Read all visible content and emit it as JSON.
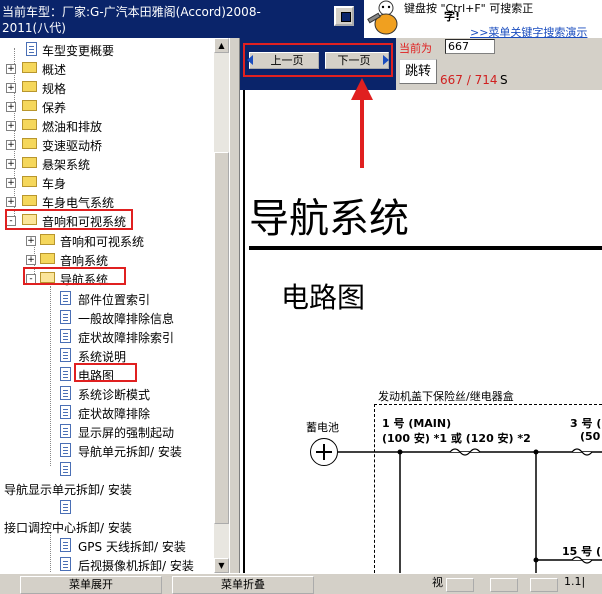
{
  "header": {
    "car_line1": "当前车型：厂家:G-广汽本田雅阁(Accord)2008-",
    "car_line2": "2011(八代)",
    "tip_line1": "键盘按 \"Ctrl+F\" 可搜索正",
    "tip_line2": "字!",
    "tip_link": ">>菜单关键字搜索演示"
  },
  "tree": {
    "items": [
      {
        "label": "车型变更概要",
        "type": "page"
      },
      {
        "label": "概述",
        "type": "folder"
      },
      {
        "label": "规格",
        "type": "folder"
      },
      {
        "label": "保养",
        "type": "folder"
      },
      {
        "label": "燃油和排放",
        "type": "folder"
      },
      {
        "label": "变速驱动桥",
        "type": "folder"
      },
      {
        "label": "悬架系统",
        "type": "folder"
      },
      {
        "label": "车身",
        "type": "folder"
      },
      {
        "label": "车身电气系统",
        "type": "folder"
      },
      {
        "label": "音响和可视系统",
        "type": "folder-open"
      },
      {
        "label": "音响和可视系统",
        "type": "folder"
      },
      {
        "label": "音响系统",
        "type": "folder"
      },
      {
        "label": "导航系统",
        "type": "folder-open"
      },
      {
        "label": "部件位置索引",
        "type": "page"
      },
      {
        "label": "一般故障排除信息",
        "type": "page"
      },
      {
        "label": "症状故障排除索引",
        "type": "page"
      },
      {
        "label": "系统说明",
        "type": "page"
      },
      {
        "label": "电路图",
        "type": "page"
      },
      {
        "label": "系统诊断模式",
        "type": "page"
      },
      {
        "label": "症状故障排除",
        "type": "page"
      },
      {
        "label": "显示屏的强制起动",
        "type": "page"
      },
      {
        "label": "导航单元拆卸/ 安装",
        "type": "page"
      },
      {
        "label": "",
        "type": "page"
      },
      {
        "label": "导航显示单元拆卸/ 安装",
        "type": "text"
      },
      {
        "label": "",
        "type": "page"
      },
      {
        "label": "接口调控中心拆卸/ 安装",
        "type": "text"
      },
      {
        "label": "GPS 天线拆卸/ 安装",
        "type": "page"
      },
      {
        "label": "后视摄像机拆卸/ 安装",
        "type": "page"
      }
    ]
  },
  "toolbar": {
    "prev_label": "上一页",
    "next_label": "下一页",
    "current_label": "当前为",
    "page_input_value": "667",
    "jump_label": "跳转",
    "page_count": "667 / 714",
    "page_count_suffix": "S"
  },
  "document": {
    "title": "导航系统",
    "subtitle": "电路图",
    "fuse_box_label": "发动机盖下保险丝/继电器盒",
    "fuse1_line1": "1 号 (MAIN)",
    "fuse1_line2": "(100 安) *1 或 (120 安) *2",
    "fuse3_line1": "3 号 (",
    "fuse3_line2": "(50",
    "fuse15": "15 号 (",
    "battery_label": "蓄电池"
  },
  "bottom": {
    "expand_label": "菜单展开",
    "collapse_label": "菜单折叠",
    "view_label": "视",
    "zoom_value": "1.1|"
  },
  "colors": {
    "title_bar": "#0a246a",
    "highlight": "#e02020",
    "count_red": "#d02020"
  }
}
